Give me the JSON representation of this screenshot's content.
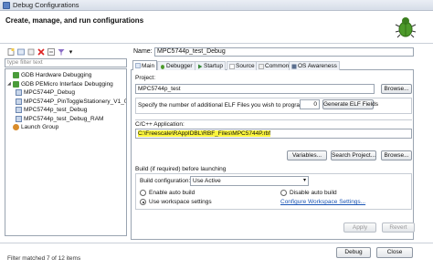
{
  "window": {
    "title": "Debug Configurations"
  },
  "header": {
    "title": "Create, manage, and run configurations"
  },
  "left": {
    "filter_placeholder": "type filter text",
    "tree": [
      {
        "label": "GDB Hardware Debugging",
        "level": 1,
        "icon": "gdb-icon"
      },
      {
        "label": "GDB PEMicro Interface Debugging",
        "level": 1,
        "icon": "gdb-icon",
        "expanded": true
      },
      {
        "label": "MPC5744P_Debug",
        "level": 2,
        "icon": "config-icon"
      },
      {
        "label": "MPC5744P_PinToggleStationery_V1_0_5",
        "level": 2,
        "icon": "config-icon"
      },
      {
        "label": "MPC5744p_test_Debug",
        "level": 2,
        "icon": "config-icon"
      },
      {
        "label": "MPC5744p_test_Debug_RAM",
        "level": 2,
        "icon": "config-icon"
      },
      {
        "label": "Launch Group",
        "level": 1,
        "icon": "launch-icon"
      }
    ],
    "status": "Filter matched 7 of 12 items"
  },
  "right": {
    "name_label": "Name:",
    "name_value": "MPC5744p_test_Debug",
    "tabs": [
      {
        "label": "Main"
      },
      {
        "label": "Debugger"
      },
      {
        "label": "Startup"
      },
      {
        "label": "Source"
      },
      {
        "label": "Common"
      },
      {
        "label": "OS Awareness"
      }
    ],
    "project_label": "Project:",
    "project_value": "MPC5744p_test",
    "browse_label": "Browse...",
    "elf_label": "Specify the number of additional ELF Files you wish to program:",
    "elf_count": "0",
    "generate_elf_label": "Generate ELF Fields",
    "app_label": "C/C++ Application:",
    "app_value": "C:\\Freescale\\RAppIDBL\\RBF_Files\\MPC5744P.rbf",
    "variables_label": "Variables...",
    "search_project_label": "Search Project...",
    "build_label": "Build (if required) before launching",
    "build_config_label": "Build configuration:",
    "build_config_value": "Use Active",
    "enable_auto_build": "Enable auto build",
    "disable_auto_build": "Disable auto build",
    "use_workspace": "Use workspace settings",
    "configure_workspace": "Configure Workspace Settings..."
  },
  "footer": {
    "apply_label": "Apply",
    "revert_label": "Revert",
    "debug_label": "Debug",
    "close_label": "Close"
  }
}
